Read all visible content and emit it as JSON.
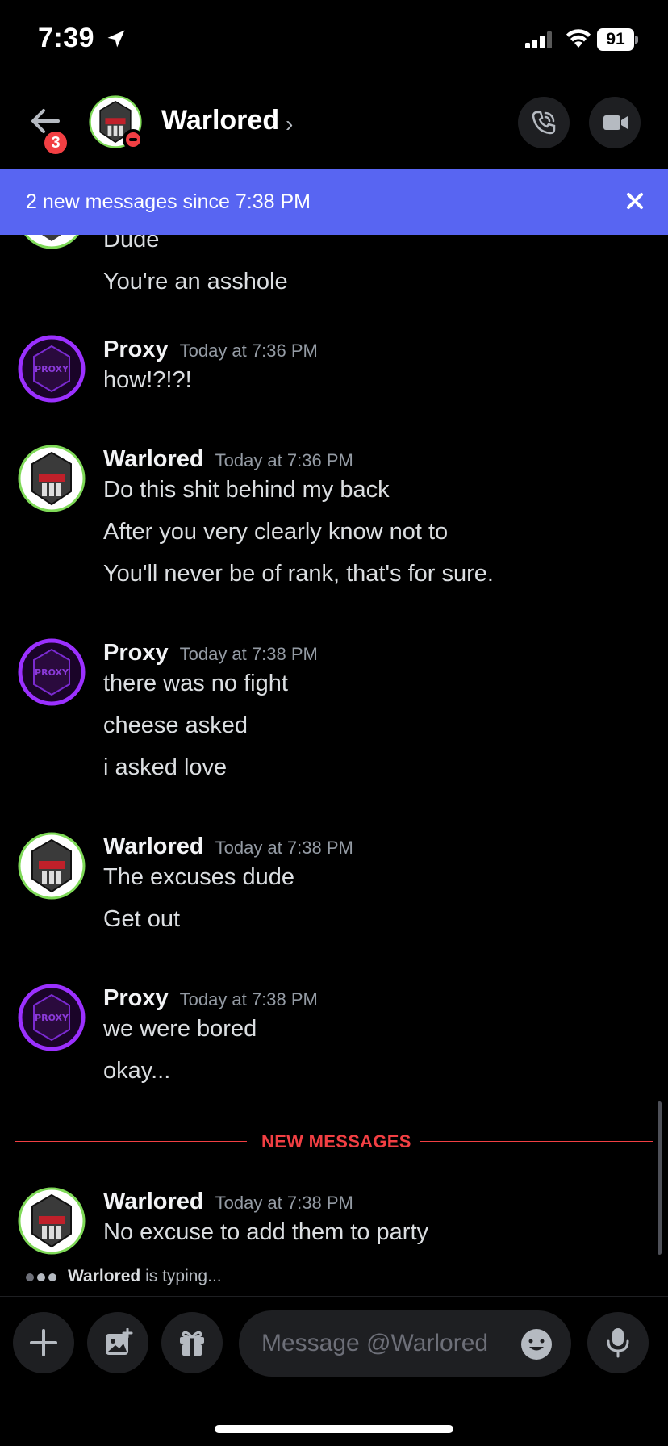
{
  "status_bar": {
    "time": "7:39",
    "battery": "91"
  },
  "header": {
    "back_badge": "3",
    "title": "Warlored",
    "chevron": "›"
  },
  "banner": {
    "text": "2 new messages since 7:38 PM"
  },
  "messages": [
    {
      "lines": [
        "Dude",
        "You're an asshole"
      ]
    },
    {
      "author": "Proxy",
      "time": "Today at 7:36 PM",
      "lines": [
        "how!?!?!"
      ]
    },
    {
      "author": "Warlored",
      "time": "Today at 7:36 PM",
      "lines": [
        "Do this shit behind my back",
        "After you very clearly know not to",
        "You'll never be of rank, that's for sure."
      ]
    },
    {
      "author": "Proxy",
      "time": "Today at 7:38 PM",
      "lines": [
        "there was no fight",
        "cheese asked",
        "i asked love"
      ]
    },
    {
      "author": "Warlored",
      "time": "Today at 7:38 PM",
      "lines": [
        "The excuses dude",
        "Get out"
      ]
    },
    {
      "author": "Proxy",
      "time": "Today at 7:38 PM",
      "lines": [
        "we were bored",
        "okay..."
      ]
    },
    {
      "author": "Warlored",
      "time": "Today at 7:38 PM",
      "lines": [
        "No excuse to add them to party"
      ]
    }
  ],
  "divider": {
    "label": "NEW MESSAGES"
  },
  "typing": {
    "name": "Warlored",
    "suffix": " is typing..."
  },
  "composer": {
    "placeholder": "Message @Warlored"
  },
  "colors": {
    "accent": "#5865f2",
    "danger": "#f23f43",
    "proxy_glow": "#9b30ff",
    "warlored_ring": "#7ed957"
  },
  "avatars": {
    "proxy_text": "PROXY"
  }
}
